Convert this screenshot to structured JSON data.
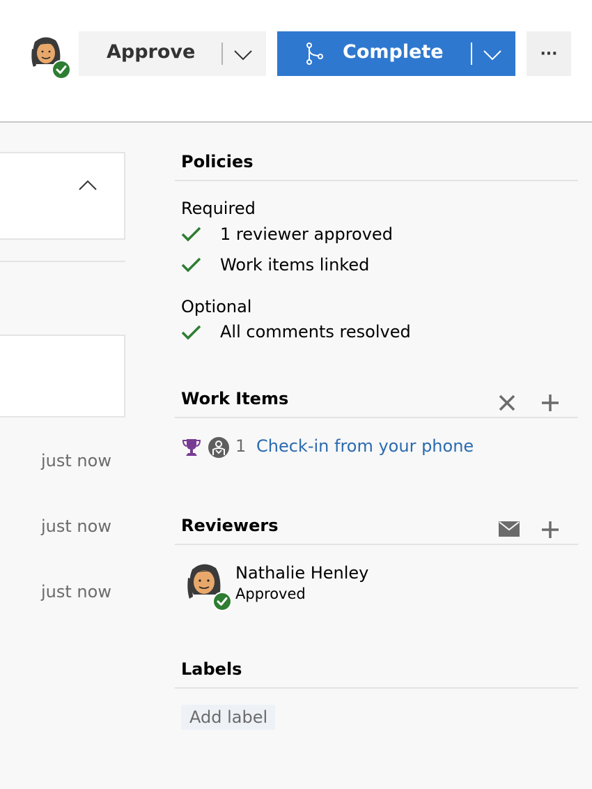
{
  "header": {
    "approve_label": "Approve",
    "complete_label": "Complete",
    "more_label": "···"
  },
  "activity": {
    "timestamps": [
      "just now",
      "just now",
      "just now"
    ]
  },
  "policies": {
    "title": "Policies",
    "required_label": "Required",
    "required_items": [
      "1 reviewer approved",
      "Work items linked"
    ],
    "optional_label": "Optional",
    "optional_items": [
      "All comments resolved"
    ]
  },
  "work_items": {
    "title": "Work Items",
    "items": [
      {
        "id": "1",
        "title": "Check-in from your phone"
      }
    ]
  },
  "reviewers": {
    "title": "Reviewers",
    "items": [
      {
        "name": "Nathalie Henley",
        "status": "Approved"
      }
    ]
  },
  "labels": {
    "title": "Labels",
    "add_label": "Add label"
  },
  "colors": {
    "primary": "#2f78cf",
    "success": "#2e7d32",
    "link": "#2a6bb0",
    "work_item_purple": "#773b93"
  },
  "icons": {
    "approve_dropdown": "chevron-down-icon",
    "complete": "branch-merge-icon",
    "more": "more-dots-icon",
    "collapse": "chevron-up-icon",
    "policy_status": "checkmark-icon",
    "remove": "close-icon",
    "add": "plus-icon",
    "email": "mail-icon",
    "work_item_type": "trophy-icon",
    "assignee": "person-icon"
  }
}
